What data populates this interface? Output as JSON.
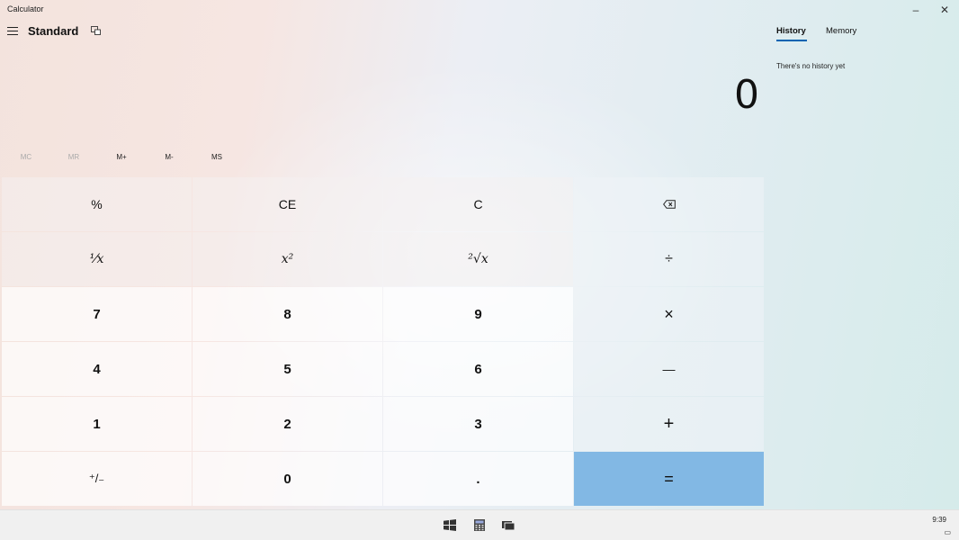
{
  "window": {
    "title": "Calculator",
    "minimize": "–",
    "close": "✕"
  },
  "header": {
    "mode": "Standard",
    "menu_icon": "hamburger-icon",
    "keep_on_top_icon": "keep-on-top-icon"
  },
  "display": {
    "value": "0"
  },
  "memory": {
    "buttons": [
      {
        "label": "MC",
        "enabled": false
      },
      {
        "label": "MR",
        "enabled": false
      },
      {
        "label": "M+",
        "enabled": true
      },
      {
        "label": "M-",
        "enabled": true
      },
      {
        "label": "MS",
        "enabled": true
      }
    ]
  },
  "keys": {
    "percent": "%",
    "ce": "CE",
    "c": "C",
    "reciprocal": "⅟x",
    "square": "x²",
    "sqrt": "²√x",
    "divide": "÷",
    "multiply": "×",
    "minus": "—",
    "plus": "+",
    "equals": "=",
    "seven": "7",
    "eight": "8",
    "nine": "9",
    "four": "4",
    "five": "5",
    "six": "6",
    "one": "1",
    "two": "2",
    "three": "3",
    "negate": "⁺/₋",
    "zero": "0",
    "decimal": "."
  },
  "side_panel": {
    "tabs": [
      "History",
      "Memory"
    ],
    "active_tab": "History",
    "empty_message": "There's no history yet"
  },
  "taskbar": {
    "time": "9:39",
    "accent_equals": "#82b8e4"
  }
}
